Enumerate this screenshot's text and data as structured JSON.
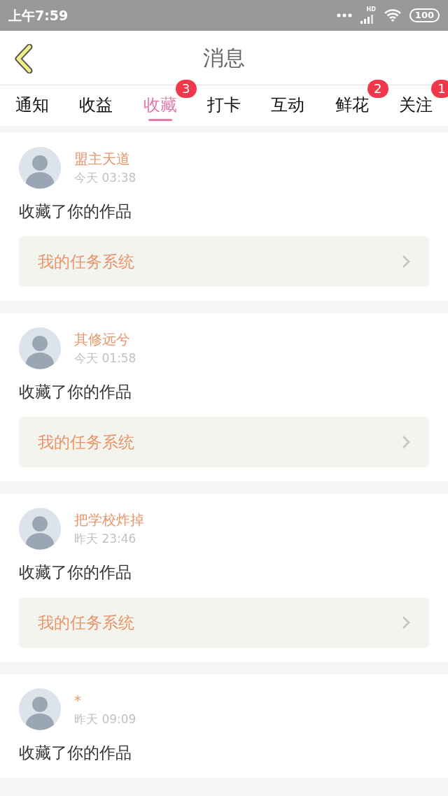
{
  "status_bar": {
    "time": "上午7:59",
    "network": "HD",
    "battery": "100"
  },
  "header": {
    "title": "消息"
  },
  "tabs": [
    {
      "label": "通知",
      "selected": false
    },
    {
      "label": "收益",
      "selected": false
    },
    {
      "label": "收藏",
      "selected": true,
      "badge": "3"
    },
    {
      "label": "打卡",
      "selected": false
    },
    {
      "label": "互动",
      "selected": false
    },
    {
      "label": "鲜花",
      "selected": false,
      "badge": "2"
    },
    {
      "label": "关注",
      "selected": false,
      "badge": "1"
    }
  ],
  "messages": [
    {
      "user": "盟主天道",
      "time": "今天 03:38",
      "text": "收藏了你的作品",
      "link": "我的任务系统"
    },
    {
      "user": "其修远兮",
      "time": "今天 01:58",
      "text": "收藏了你的作品",
      "link": "我的任务系统"
    },
    {
      "user": "把学校炸掉",
      "time": "昨天 23:46",
      "text": "收藏了你的作品",
      "link": "我的任务系统"
    },
    {
      "user": "*",
      "time": "昨天 09:09",
      "text": "收藏了你的作品"
    }
  ]
}
